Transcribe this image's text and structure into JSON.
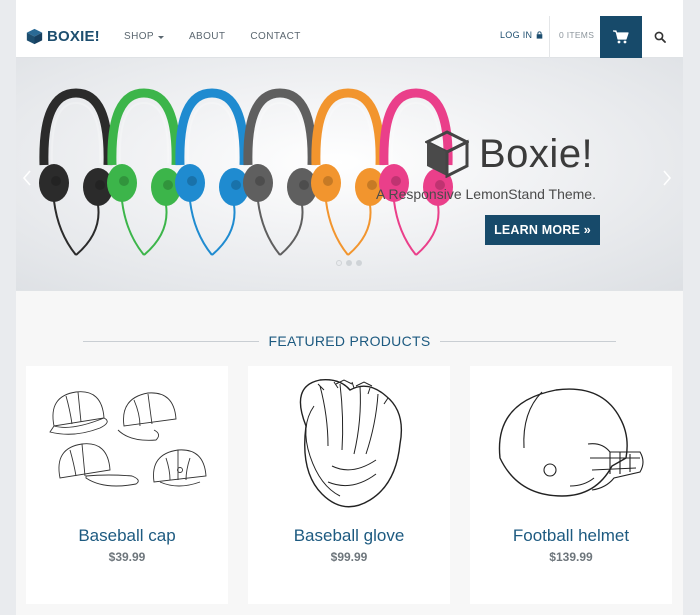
{
  "header": {
    "logo_text": "BOXIE!",
    "nav": [
      {
        "label": "SHOP",
        "has_dropdown": true
      },
      {
        "label": "ABOUT"
      },
      {
        "label": "CONTACT"
      }
    ],
    "login_label": "LOG IN",
    "cart_items_label": "0 ITEMS"
  },
  "hero": {
    "title": "Boxie!",
    "subtitle": "A Responsive LemonStand Theme.",
    "button_label": "LEARN MORE »",
    "headphone_colors": [
      "#2b2b2b",
      "#3cb54a",
      "#1f8bd0",
      "#5f5f5f",
      "#f2952e",
      "#ea3f8a"
    ],
    "slide_count": 3,
    "active_slide": 0
  },
  "featured": {
    "title": "FEATURED PRODUCTS",
    "products": [
      {
        "name": "Baseball cap",
        "price": "$39.99"
      },
      {
        "name": "Baseball glove",
        "price": "$99.99"
      },
      {
        "name": "Football helmet",
        "price": "$139.99"
      }
    ]
  },
  "colors": {
    "brand": "#174a6a",
    "link": "#1d5a80",
    "background": "#e9ebee"
  }
}
